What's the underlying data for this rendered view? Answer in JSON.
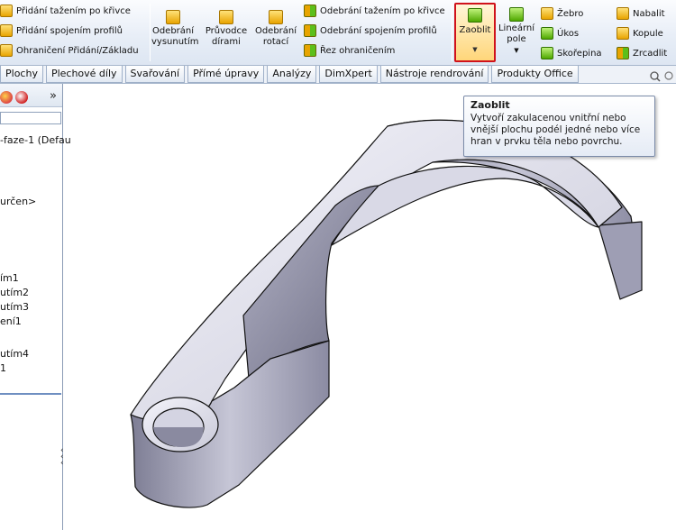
{
  "ribbon": {
    "col1": [
      "Přidání tažením po křivce",
      "Přidání spojením profilů",
      "Ohraničení Přidání/Základu"
    ],
    "big_buttons": [
      {
        "line1": "Odebrání",
        "line2": "vysunutím"
      },
      {
        "line1": "Průvodce",
        "line2": "dírami"
      },
      {
        "line1": "Odebrání",
        "line2": "rotací"
      }
    ],
    "col2": [
      "Odebrání tažením po křivce",
      "Odebrání spojením profilů",
      "Řez ohraničením"
    ],
    "zaoblit": "Zaoblit",
    "linear_pattern": {
      "line1": "Lineární",
      "line2": "pole"
    },
    "col3": [
      "Žebro",
      "Úkos",
      "Skořepina"
    ],
    "col4": [
      "Nabalit",
      "Kopule",
      "Zrcadlit"
    ]
  },
  "tabs": [
    "Plochy",
    "Plechové díly",
    "Svařování",
    "Přímé úpravy",
    "Analýzy",
    "DimXpert",
    "Nástroje rendrování",
    "Produkty Office"
  ],
  "panel": {
    "expand": "»",
    "tree": [
      "-faze-1  (Defau",
      "určen>",
      "ím1",
      "utím2",
      "utím3",
      "ení1",
      "utím4",
      "1"
    ]
  },
  "tooltip": {
    "title": "Zaoblit",
    "lines": [
      "Vytvoří zakulacenou vnitřní nebo",
      "vnější plochu podél jedné nebo více",
      "hran v prvku těla nebo povrchu."
    ]
  },
  "colors": {
    "highlight": "#d0121b",
    "tab_bg": "#e2e9f3",
    "panel_border": "#8a9bb5"
  }
}
